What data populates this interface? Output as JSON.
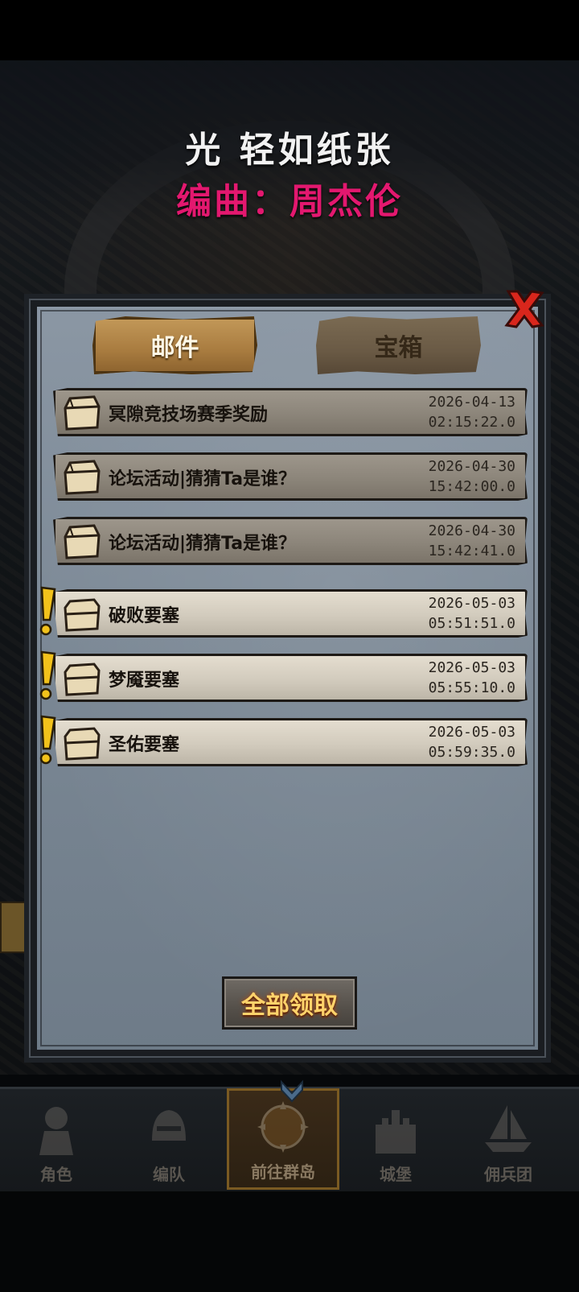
{
  "lyrics": {
    "line1": "光 轻如纸张",
    "line2": "编曲：周杰伦"
  },
  "dialog": {
    "tabs": [
      {
        "label": "邮件",
        "active": true
      },
      {
        "label": "宝箱",
        "active": false
      }
    ],
    "mails": [
      {
        "title": "冥隙竞技场赛季奖励",
        "date": "2026-04-13",
        "time": "02:15:22.0",
        "unread": false
      },
      {
        "title": "论坛活动|猜猜Ta是谁？",
        "date": "2026-04-30",
        "time": "15:42:00.0",
        "unread": false
      },
      {
        "title": "论坛活动|猜猜Ta是谁？",
        "date": "2026-04-30",
        "time": "15:42:41.0",
        "unread": false
      },
      {
        "title": "破败要塞",
        "date": "2026-05-03",
        "time": "05:51:51.0",
        "unread": true
      },
      {
        "title": "梦魇要塞",
        "date": "2026-05-03",
        "time": "05:55:10.0",
        "unread": true
      },
      {
        "title": "圣佑要塞",
        "date": "2026-05-03",
        "time": "05:59:35.0",
        "unread": true
      }
    ],
    "claim_all_label": "全部领取"
  },
  "nav": {
    "items": [
      {
        "label": "角色",
        "icon": "knight-icon"
      },
      {
        "label": "编队",
        "icon": "helmet-icon"
      },
      {
        "label": "前往群岛",
        "icon": "island-compass-icon"
      },
      {
        "label": "城堡",
        "icon": "castle-icon"
      },
      {
        "label": "佣兵团",
        "icon": "ship-icon"
      }
    ],
    "active_index": 2
  },
  "colors": {
    "lyric_primary": "#f2f2f2",
    "lyric_accent": "#e3186f",
    "claim_text": "#ffd36b",
    "alert": "#f2c21b",
    "close_red": "#d9261c"
  }
}
